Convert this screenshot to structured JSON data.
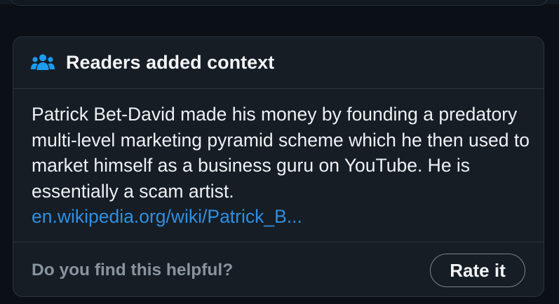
{
  "note": {
    "header_icon": "people-group-icon",
    "header_title": "Readers added context",
    "body_text": "Patrick Bet-David made his money by founding a predatory multi-level marketing pyramid scheme which he then used to market himself as a business guru on YouTube. He is essentially a scam artist.",
    "link_text": "en.wikipedia.org/wiki/Patrick_B...",
    "footer_question": "Do you find this helpful?",
    "rate_button_label": "Rate it"
  },
  "colors": {
    "background": "#0b1016",
    "card_background": "#161d25",
    "border": "#2c343d",
    "title_text": "#f3f5f7",
    "body_text": "#eef1f4",
    "link": "#2f8fe0",
    "muted_text": "#8a949e",
    "icon": "#1d9bf0"
  }
}
